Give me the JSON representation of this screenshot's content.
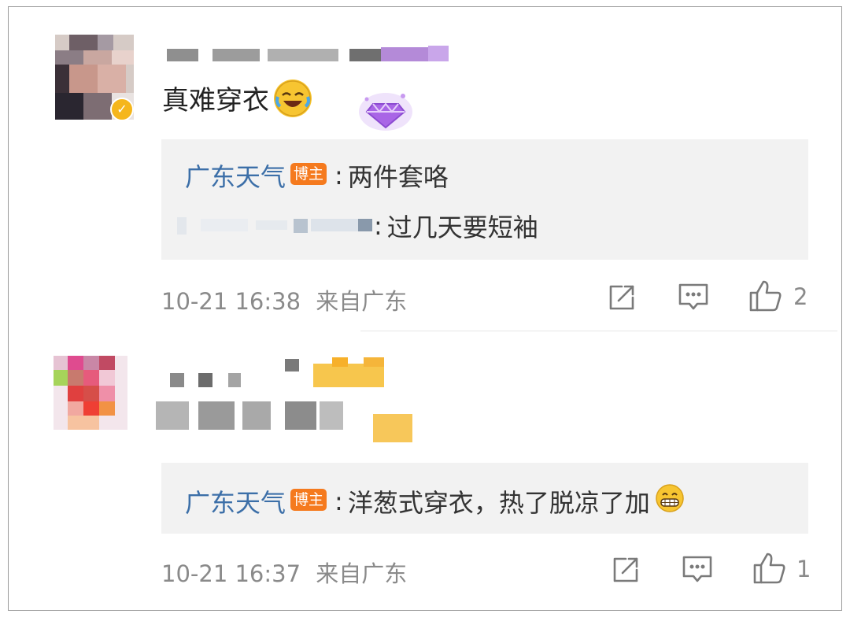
{
  "comments": [
    {
      "text": "真难穿衣",
      "replies": [
        {
          "author": "广东天气",
          "badge": "博主",
          "text": "两件套咯"
        },
        {
          "author": "",
          "text": "过几天要短袖"
        }
      ],
      "time": "10-21 16:38",
      "source": "来自广东",
      "likes": "2"
    },
    {
      "text": "",
      "replies": [
        {
          "author": "广东天气",
          "badge": "博主",
          "text": "洋葱式穿衣，热了脱凉了加"
        }
      ],
      "time": "10-21 16:37",
      "source": "来自广东",
      "likes": "1"
    }
  ],
  "icons": {
    "share": "share-icon",
    "comment": "comment-icon",
    "like": "thumbs-up-icon",
    "laugh_emoji": "laughing-crying-emoji",
    "grin_emoji": "grinning-emoji",
    "vip": "diamond-badge-icon"
  },
  "colors": {
    "author": "#3c6fa8",
    "badge": "#f57a1e",
    "reply_bg": "#f2f2f2",
    "meta": "#8a8a8a"
  }
}
